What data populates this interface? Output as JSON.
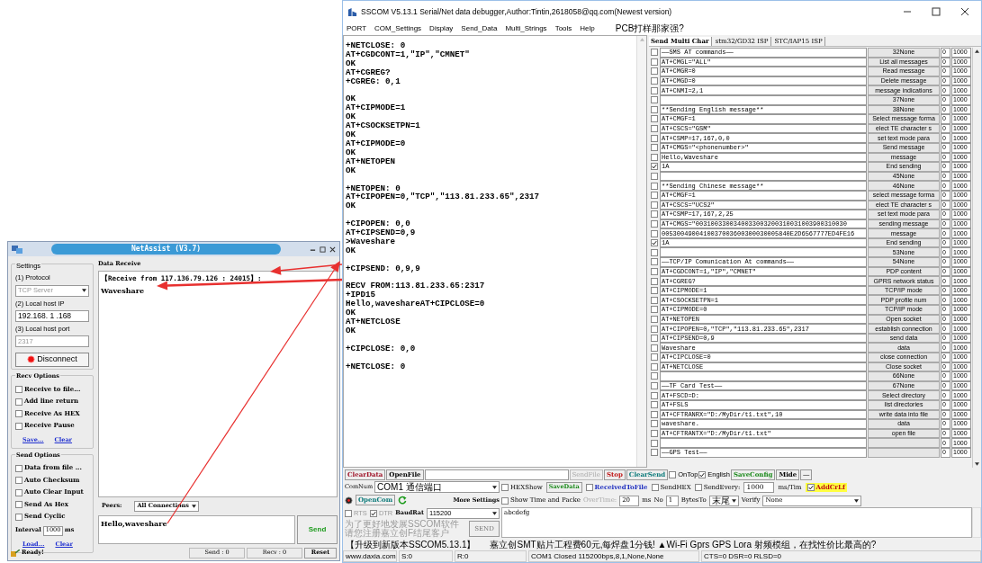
{
  "netassist": {
    "title": "NetAssist (V3.7)",
    "settings": {
      "heading": "Settings",
      "protocol_label": "(1) Protocol",
      "protocol": {
        "value": "TCP Server",
        "disabled": true
      },
      "ip_label": "(2) Local host IP",
      "ip": "192.168. 1 .168",
      "port_label": "(3) Local host port",
      "port": {
        "value": "2317",
        "disabled": true
      },
      "connect_button": "Disconnect"
    },
    "recv_options": {
      "heading": "Recv Options",
      "options": [
        {
          "label": "Receive to file...",
          "checked": false
        },
        {
          "label": "Add line return",
          "checked": false
        },
        {
          "label": "Receive As HEX",
          "checked": false
        },
        {
          "label": "Receive Pause",
          "checked": false
        }
      ],
      "links": [
        "Save...",
        "Clear"
      ]
    },
    "send_options": {
      "heading": "Send Options",
      "options": [
        {
          "label": "Data from file ...",
          "checked": false
        },
        {
          "label": "Auto Checksum",
          "checked": false
        },
        {
          "label": "Auto Clear Input",
          "checked": false
        },
        {
          "label": "Send As Hex",
          "checked": false
        },
        {
          "label": "Send Cyclic",
          "checked": false
        }
      ],
      "interval_label": "Interval",
      "interval": "1000",
      "interval_unit": "ms",
      "links": [
        "Load...",
        "Clear"
      ]
    },
    "data_receive": {
      "heading": "Data Receive",
      "header": "【Receive from 117.136.79.126 : 24015】:",
      "text": "Waveshare"
    },
    "peers_label": "Peers:",
    "peers": "All Connections",
    "send_text": "Hello,waveshare",
    "send_button": "Send",
    "status": "Ready!",
    "send_count": "Send : 0",
    "recv_count": "Recv : 0",
    "reset_button": "Reset"
  },
  "sscom": {
    "title": "SSCOM V5.13.1 Serial/Net data debugger,Author:Tintin,2618058@qq.com(Newest version)",
    "menu": [
      "PORT",
      "COM_Settings",
      "Display",
      "Send_Data",
      "Multi_Strings",
      "Tools",
      "Help",
      "PCB打样那家强?"
    ],
    "terminal": "+NETCLOSE: 0\nAT+CGDCONT=1,\"IP\",\"CMNET\"\nOK\nAT+CGREG?\n+CGREG: 0,1\n\nOK\nAT+CIPMODE=1\nOK\nAT+CSOCKSETPN=1\nOK\nAT+CIPMODE=0\nOK\nAT+NETOPEN\nOK\n\n+NETOPEN: 0\nAT+CIPOPEN=0,\"TCP\",\"113.81.233.65\",2317\nOK\n\n+CIPOPEN: 0,0\nAT+CIPSEND=0,9\n>Waveshare\nOK\n\n+CIPSEND: 0,9,9\n\nRECV FROM:113.81.233.65:2317\n+IPD15\nHello,wavesharеAT+CIPCLOSE=0\nOK\nAT+NETCLOSE\nOK\n\n+CIPCLOSE: 0,0\n\n+NETCLOSE: 0",
    "tabs": [
      {
        "label": "Send Multi Char",
        "selected": true
      },
      {
        "label": "stm32/GD32 ISP",
        "selected": false
      },
      {
        "label": "STC/IAP15 ISP",
        "selected": false
      }
    ],
    "rows": [
      {
        "checked": false,
        "command": "——SMS AT commands——",
        "button": "32None",
        "column_4": "0",
        "column_5": "1000"
      },
      {
        "checked": false,
        "command": "AT+CMGL=\"ALL\"",
        "button": "List all messages",
        "column_4": "0",
        "column_5": "1000"
      },
      {
        "checked": false,
        "command": "AT+CMGR=0",
        "button": "Read message",
        "column_4": "0",
        "column_5": "1000"
      },
      {
        "checked": false,
        "command": "AT+CMGD=0",
        "button": "Delete message",
        "column_4": "0",
        "column_5": "1000"
      },
      {
        "checked": false,
        "command": "AT+CNMI=2,1",
        "button": "message indications",
        "column_4": "0",
        "column_5": "1000"
      },
      {
        "checked": false,
        "button": "37None",
        "column_4": "0",
        "column_5": "1000"
      },
      {
        "checked": false,
        "command": "**Sending English message**",
        "button": "38None",
        "column_4": "0",
        "column_5": "1000"
      },
      {
        "checked": false,
        "command": "AT+CMGF=1",
        "button": "Select message forma",
        "column_4": "0",
        "column_5": "1000"
      },
      {
        "checked": false,
        "command": "AT+CSCS=\"GSM\"",
        "button": "elect TE character s",
        "column_4": "0",
        "column_5": "1000"
      },
      {
        "checked": false,
        "command": "AT+CSMP=17,167,0,0",
        "button": "set text mode para",
        "column_4": "0",
        "column_5": "1000"
      },
      {
        "checked": false,
        "command": "AT+CMGS=\"<phonenumber>\"",
        "button": "Send message",
        "column_4": "0",
        "column_5": "1000"
      },
      {
        "checked": false,
        "command": "Hello,Waveshare",
        "button": "message",
        "column_4": "0",
        "column_5": "1000"
      },
      {
        "checked": true,
        "command": "1A",
        "button": "End sending",
        "column_4": "0",
        "column_5": "1000"
      },
      {
        "checked": false,
        "button": "45None",
        "column_4": "0",
        "column_5": "1000"
      },
      {
        "checked": false,
        "command": "**Sending Chinese message**",
        "button": "46None",
        "column_4": "0",
        "column_5": "1000"
      },
      {
        "checked": false,
        "command": "AT+CMGF=1",
        "button": "select message forma",
        "column_4": "0",
        "column_5": "1000"
      },
      {
        "checked": false,
        "command": "AT+CSCS=\"UCS2\"",
        "button": "elect TE character s",
        "column_4": "0",
        "column_5": "1000"
      },
      {
        "checked": false,
        "command": "AT+CSMP=17,167,2,25",
        "button": "set text mode para",
        "column_4": "0",
        "column_5": "1000"
      },
      {
        "checked": false,
        "command": "AT+CMGS=\"0031003300340033003200310031003900310030",
        "button": "sending message",
        "column_4": "0",
        "column_5": "1000"
      },
      {
        "checked": false,
        "command": "0053004900410037003600300030005840E2D6567777ED4FE16",
        "button": "message",
        "column_4": "0",
        "column_5": "1000"
      },
      {
        "checked": true,
        "command": "1A",
        "button": "End sending",
        "column_4": "0",
        "column_5": "1000"
      },
      {
        "checked": false,
        "button": "53None",
        "column_4": "0",
        "column_5": "1000"
      },
      {
        "checked": false,
        "command": "——TCP/IP Comunication At commands——",
        "button": "54None",
        "column_4": "0",
        "column_5": "1000"
      },
      {
        "checked": false,
        "command": "AT+CGDCONT=1,\"IP\",\"CMNET\"",
        "button": "PDP content",
        "column_4": "0",
        "column_5": "1000"
      },
      {
        "checked": false,
        "command": "AT+CGREG?",
        "button": "GPRS network status",
        "column_4": "0",
        "column_5": "1000"
      },
      {
        "checked": false,
        "command": "AT+CIPMODE=1",
        "button": "TCP/IP mode",
        "column_4": "0",
        "column_5": "1000"
      },
      {
        "checked": false,
        "command": "AT+CSOCKSETPN=1",
        "button": "PDP profile num",
        "column_4": "0",
        "column_5": "1000"
      },
      {
        "checked": false,
        "command": "AT+CIPMODE=0",
        "button": "TCP/IP mode",
        "column_4": "0",
        "column_5": "1000"
      },
      {
        "checked": false,
        "command": "AT+NETOPEN",
        "button": "Open socket",
        "column_4": "0",
        "column_5": "1000"
      },
      {
        "checked": false,
        "command": "AT+CIPOPEN=0,\"TCP\",\"113.81.233.65\",2317",
        "button": "establish connection",
        "column_4": "0",
        "column_5": "1000"
      },
      {
        "checked": false,
        "command": "AT+CIPSEND=0,9",
        "button": "send data",
        "column_4": "0",
        "column_5": "1000"
      },
      {
        "checked": false,
        "command": "Waveshare",
        "button": "data",
        "column_4": "0",
        "column_5": "1000"
      },
      {
        "checked": false,
        "command": "AT+CIPCLOSE=0",
        "button": "close connection",
        "column_4": "0",
        "column_5": "1000"
      },
      {
        "checked": false,
        "command": "AT+NETCLOSE",
        "button": "Close socket",
        "column_4": "0",
        "column_5": "1000"
      },
      {
        "checked": false,
        "button": "66None",
        "column_4": "0",
        "column_5": "1000"
      },
      {
        "checked": false,
        "command": "——TF Card Test——",
        "button": "67None",
        "column_4": "0",
        "column_5": "1000"
      },
      {
        "checked": false,
        "command": "AT+FSCD=D:",
        "button": "Select directory",
        "column_4": "0",
        "column_5": "1000"
      },
      {
        "checked": false,
        "command": "AT+FSLS",
        "button": "list directories",
        "column_4": "0",
        "column_5": "1000"
      },
      {
        "checked": false,
        "command": "AT+CFTRANRX=\"D:/MyDir/t1.txt\",10",
        "button": "write data into file",
        "column_4": "0",
        "column_5": "1000"
      },
      {
        "checked": false,
        "command": "waveshare.",
        "button": "data",
        "column_4": "0",
        "column_5": "1000"
      },
      {
        "checked": false,
        "command": "AT+CFTRANTX=\"D:/MyDir/t1.txt\"",
        "button": "open file",
        "column_4": "0",
        "column_5": "1000"
      },
      {
        "checked": false,
        "column_4": "0",
        "column_5": "1000"
      },
      {
        "checked": false,
        "command": "——GPS Test——",
        "column_4": "0",
        "column_5": "1000"
      }
    ],
    "toolbar": {
      "clear_data": "ClearData",
      "open_file": "OpenFile",
      "send_file": {
        "label": "SendFile",
        "disabled": true
      },
      "stop": "Stop",
      "clear_send": "ClearSend",
      "on_top": {
        "label": "OnTop",
        "checked": false
      },
      "english": {
        "label": "English",
        "checked": true
      },
      "save_config": "SaveConfig",
      "mide": "Mide",
      "collapse": "—"
    },
    "com": {
      "com_label": "ComNum",
      "com_port": "COM1 通信端口",
      "open_com": "OpenCom",
      "more_settings": "More Settings",
      "rts": {
        "label": "RTS",
        "checked": false,
        "disabled": true
      },
      "dtr": {
        "label": "DTR",
        "checked": true,
        "disabled": true
      },
      "baud_label": "BaudRat",
      "baud": "115200"
    },
    "options": {
      "hex_show": {
        "label": "HEXShow",
        "checked": false
      },
      "save_data": "SaveData",
      "received_to_file": {
        "label": "ReceivedToFile",
        "checked": false
      },
      "send_hex": {
        "label": "SendHEX",
        "checked": false
      },
      "send_every": {
        "label": "SendEvery:",
        "checked": false
      },
      "every_value": "1000",
      "every_unit": "ms/Tim",
      "add_crlf": {
        "label": "AddCrLf",
        "checked": true
      },
      "show_time": {
        "label": "Show Time and Packe",
        "checked": false
      },
      "overtime_label": "OverTime:",
      "overtime": "20",
      "overtime_unit": "ms",
      "no_label": "No",
      "no": "1",
      "bytes_label": "BytesTo",
      "bytes_to": "末尾",
      "verify_label": "Verify",
      "verify": "None"
    },
    "send_text": "abcdefg",
    "promo": [
      "为了更好地发展SSCOM软件",
      "请您注册嘉立创F结尾客户"
    ],
    "send_button": "SEND",
    "upgrade": "【升级到新版本SSCOM5.13.1】",
    "ad": "嘉立创SMT贴片工程费60元,每焊盘1分钱! ▲Wi-Fi Gprs GPS Lora 射频模组，在找性价比最高的?",
    "status": [
      "www.daxia.com",
      "S:0",
      "R:0",
      "COM1 Closed  115200bps,8,1,None,None",
      "CTS=0 DSR=0 RLSD=0"
    ]
  }
}
